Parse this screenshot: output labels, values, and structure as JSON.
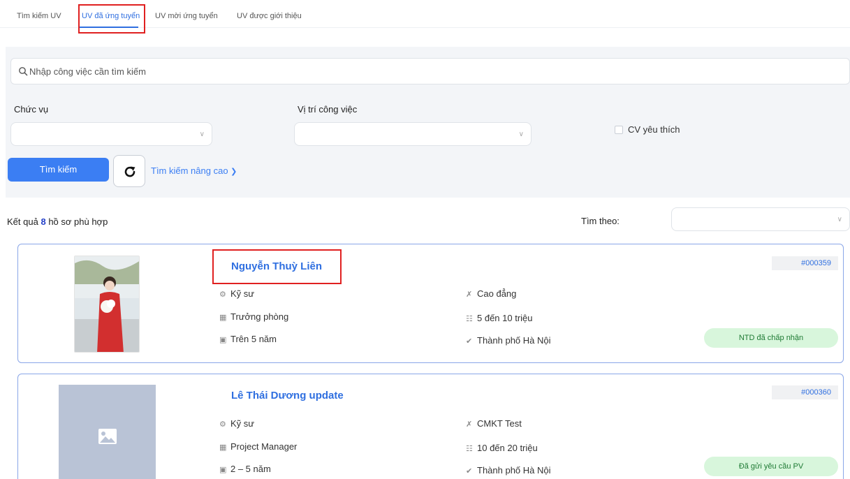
{
  "tabs": [
    {
      "label": "Tìm kiếm UV"
    },
    {
      "label": "UV đã ứng tuyển"
    },
    {
      "label": "UV mời ứng tuyển"
    },
    {
      "label": "UV được giới thiệu"
    }
  ],
  "search": {
    "placeholder": "Nhập công việc cần tìm kiếm"
  },
  "filters": {
    "position_label": "Chức vụ",
    "location_label": "Vị trí công việc",
    "favorite_label": "CV yêu thích"
  },
  "actions": {
    "search_label": "Tìm kiếm",
    "advanced_label": "Tìm kiếm nâng cao"
  },
  "results": {
    "prefix": "Kết quả",
    "count": "8",
    "suffix": "hồ sơ phù hợp",
    "sort_label": "Tìm theo:"
  },
  "candidates": [
    {
      "name": "Nguyễn Thuỳ Liên",
      "code": "#000359",
      "title": "Kỹ sư",
      "role": "Trưởng phòng",
      "experience": "Trên 5 năm",
      "education": "Cao đẳng",
      "salary": "5 đến 10 triệu",
      "city": "Thành phố Hà Nội",
      "status": "NTD đã chấp nhận"
    },
    {
      "name": "Lê Thái Dương update",
      "code": "#000360",
      "title": "Kỹ sư",
      "role": "Project Manager",
      "experience": "2 – 5 năm",
      "education": "CMKT Test",
      "salary": "10 đến 20 triệu",
      "city": "Thành phố Hà Nội",
      "status": "Đã gửi yêu cầu PV"
    }
  ]
}
